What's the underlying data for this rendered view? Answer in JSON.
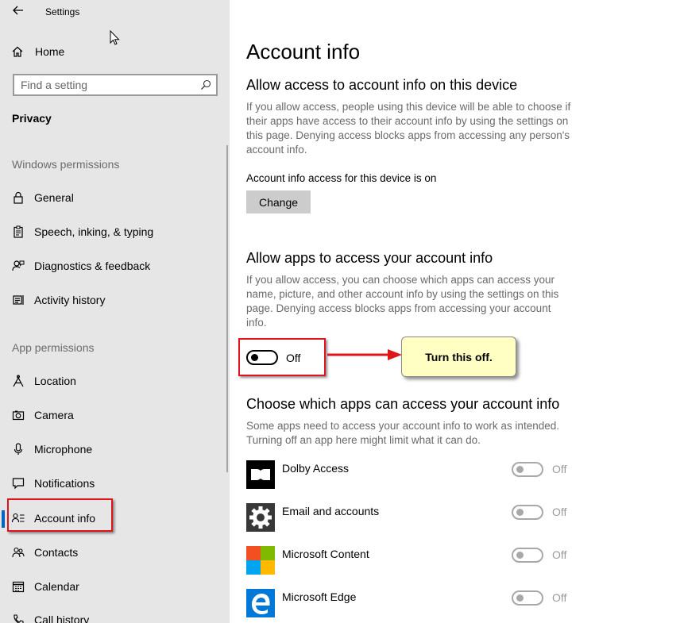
{
  "window": {
    "title": "Settings"
  },
  "sidebar": {
    "home_label": "Home",
    "search_placeholder": "Find a setting",
    "section_title": "Privacy",
    "windows_permissions_header": "Windows permissions",
    "windows_items": [
      {
        "label": "General",
        "icon": "lock-icon"
      },
      {
        "label": "Speech, inking, & typing",
        "icon": "clipboard-icon"
      },
      {
        "label": "Diagnostics & feedback",
        "icon": "feedback-icon"
      },
      {
        "label": "Activity history",
        "icon": "history-icon"
      }
    ],
    "app_permissions_header": "App permissions",
    "app_items": [
      {
        "label": "Location",
        "icon": "location-icon"
      },
      {
        "label": "Camera",
        "icon": "camera-icon"
      },
      {
        "label": "Microphone",
        "icon": "microphone-icon"
      },
      {
        "label": "Notifications",
        "icon": "notifications-icon"
      },
      {
        "label": "Account info",
        "icon": "account-info-icon",
        "active": true
      },
      {
        "label": "Contacts",
        "icon": "contacts-icon"
      },
      {
        "label": "Calendar",
        "icon": "calendar-icon"
      },
      {
        "label": "Call history",
        "icon": "call-history-icon"
      }
    ]
  },
  "main": {
    "title": "Account info",
    "device_section": {
      "heading": "Allow access to account info on this device",
      "description": "If you allow access, people using this device will be able to choose if their apps have access to their account info by using the settings on this page. Denying access blocks apps from accessing any person's account info.",
      "status": "Account info access for this device is on",
      "change_label": "Change"
    },
    "apps_section": {
      "heading": "Allow apps to access your account info",
      "description": "If you allow access, you can choose which apps can access your name, picture, and other account info by using the settings on this page. Denying access blocks apps from accessing your account info.",
      "toggle_label": "Off",
      "toggle_on": false
    },
    "callout_note": "Turn this off.",
    "choose_section": {
      "heading": "Choose which apps can access your account info",
      "description": "Some apps need to access your account info to work as intended. Turning off an app here might limit what it can do.",
      "apps": [
        {
          "name": "Dolby Access",
          "state": "Off",
          "icon": "dolby-icon"
        },
        {
          "name": "Email and accounts",
          "state": "Off",
          "icon": "gear-icon"
        },
        {
          "name": "Microsoft Content",
          "state": "Off",
          "icon": "microsoft-logo-icon"
        },
        {
          "name": "Microsoft Edge",
          "state": "Off",
          "icon": "edge-icon"
        }
      ]
    },
    "colors": {
      "accent": "#0067c0",
      "callout": "#e0141b",
      "note_bg": "#ffffc4",
      "sidebar_bg": "#e6e6e6"
    }
  }
}
